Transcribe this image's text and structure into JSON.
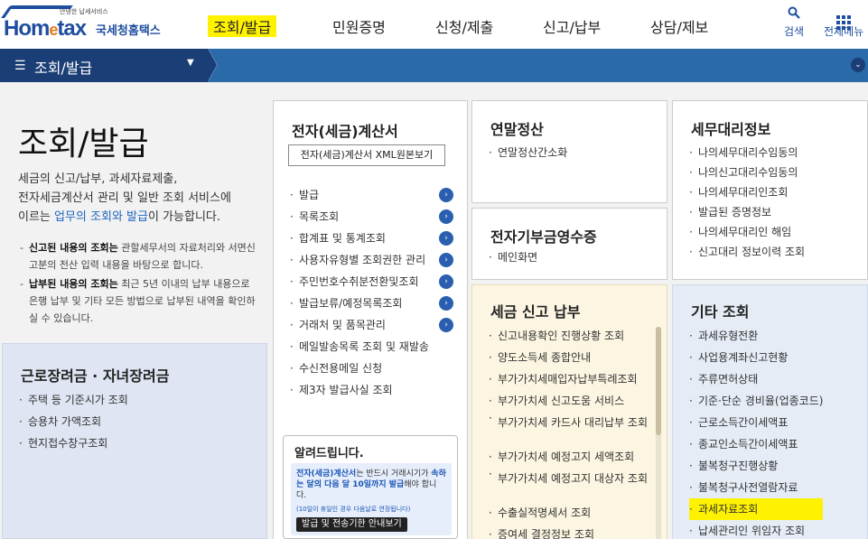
{
  "header": {
    "logo_tagline": "안녕한 납세서비스",
    "logo_main_a": "Hom",
    "logo_main_e": "e",
    "logo_main_b": "tax",
    "logo_kor": "국세청홈택스",
    "menu": [
      "조회/발급",
      "민원증명",
      "신청/제출",
      "신고/납부",
      "상담/제보"
    ],
    "active_menu": "조회/발급",
    "search_label": "검색",
    "all_menu_label": "전체메뉴"
  },
  "nav": {
    "title": "조회/발급"
  },
  "intro": {
    "title": "조회/발급",
    "desc_1": "세금의 신고/납부, 과세자료제출,",
    "desc_2": "전자세금계산서 관리 및 일반 조회 서비스에",
    "desc_3a": "이르는 ",
    "desc_3_link": "업무의 조회와 발급",
    "desc_3b": "이 가능합니다.",
    "note1_bold": "신고된 내용의 조회는",
    "note1_rest": " 관할세무서의 자료처리와 서면신고분의 전산 입력 내용을 바탕으로 합니다.",
    "note2_bold": "납부된 내용의 조회는",
    "note2_rest": " 최근 5년 이내의 납부 내용으로 은행 납부 및 기타 모든 방법으로 납부된 내역을 확인하실 수 있습니다."
  },
  "left_box": {
    "title": "근로장려금 · 자녀장려금",
    "items": [
      "주택 등 기준시가 조회",
      "승용차 가액조회",
      "현지접수창구조회"
    ]
  },
  "einvoice": {
    "title": "전자(세금)계산서",
    "xml_button": "전자(세금)계산서 XML원본보기",
    "items": [
      "발급",
      "목록조회",
      "합계표 및 통계조회",
      "사용자유형별 조회권한 관리",
      "주민번호수취분전환및조회",
      "발급보류/예정목록조회",
      "거래처 및 품목관리",
      "메일발송목록 조회 및 재발송",
      "수신전용메일 신청",
      "제3자 발급사실 조회"
    ],
    "notice_title": "알려드립니다.",
    "notice_hl": "전자(세금)계산서",
    "notice_text_1": "는 반드시 거래시기가 ",
    "notice_hl2": "속하는 달의 다음 달 10일까지 발급",
    "notice_text_2": "해야 합니다.",
    "notice_small": "(10일이 휴일인 경우 다음날로 연장됩니다)",
    "notice_button": "발급 및 전송기한 안내보기"
  },
  "yearend": {
    "title": "연말정산",
    "items": [
      "연말정산간소화"
    ]
  },
  "donation": {
    "title": "전자기부금영수증",
    "items": [
      "메인화면"
    ]
  },
  "taxfile": {
    "title": "세금 신고 납부",
    "items": [
      "신고내용확인 진행상황 조회",
      "양도소득세 종합안내",
      "부가가치세매입자납부특례조회",
      "부가가치세 신고도움 서비스",
      "부가가치세 카드사 대리납부 조회",
      "부가가치세 예정고지 세액조회",
      "부가가치세 예정고지 대상자 조회",
      "수출실적명세서 조회",
      "증여세 결정정보 조회"
    ]
  },
  "agent": {
    "title": "세무대리정보",
    "items": [
      "나의세무대리수임동의",
      "나의신고대리수임동의",
      "나의세무대리인조회",
      "발급된 증명정보",
      "나의세무대리인 해임",
      "신고대리 정보이력 조회"
    ]
  },
  "other": {
    "title": "기타 조회",
    "items": [
      "과세유형전환",
      "사업용계좌신고현황",
      "주류면허상태",
      "기준·단순 경비율(업종코드)",
      "근로소득간이세액표",
      "종교인소득간이세액표",
      "불복청구진행상황",
      "불복청구사전열람자료",
      "과세자료조회",
      "납세관리인 위임자 조회"
    ],
    "highlighted": "과세자료조회"
  },
  "colors": {
    "brand": "#1f4ea0",
    "nav_dark": "#1a3e75",
    "nav": "#2b6aa8",
    "highlight": "#fff200"
  }
}
